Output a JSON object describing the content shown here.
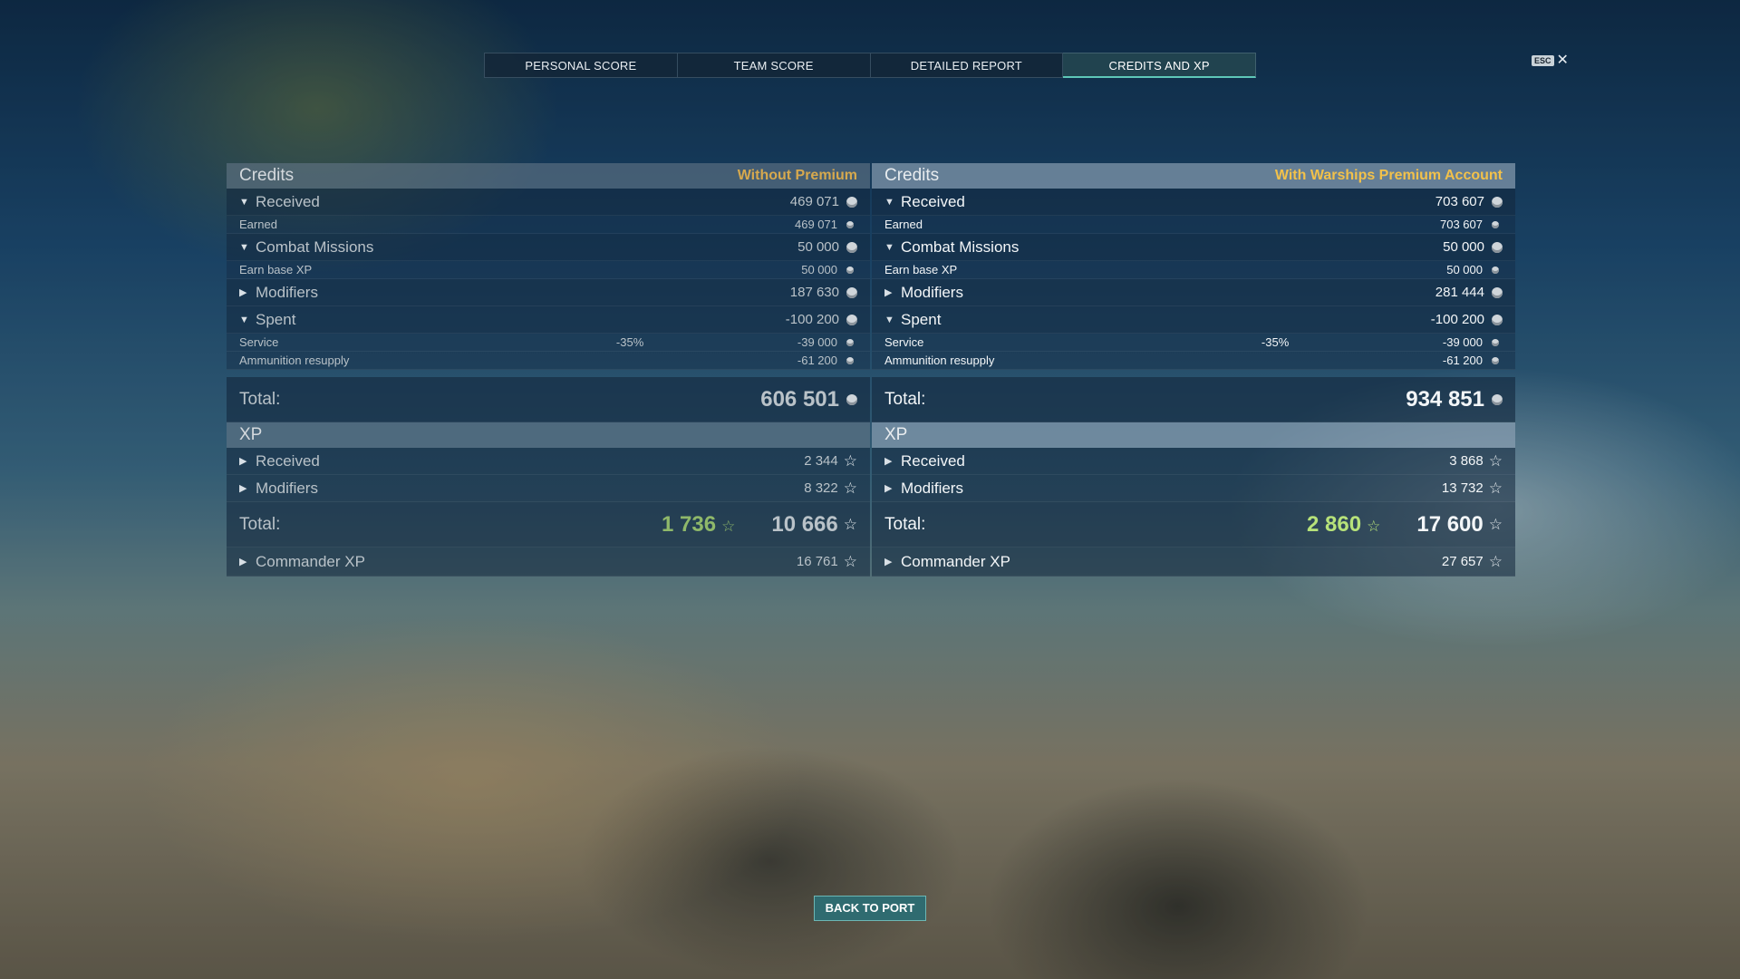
{
  "tabs": [
    "PERSONAL SCORE",
    "TEAM SCORE",
    "DETAILED REPORT",
    "CREDITS AND XP"
  ],
  "active_tab": "CREDITS AND XP",
  "esc_label": "ESC",
  "left": {
    "credits_title": "Credits",
    "note": "Without Premium",
    "received_label": "Received",
    "received_value": "469 071",
    "earned_label": "Earned",
    "earned_value": "469 071",
    "missions_label": "Combat Missions",
    "missions_value": "50 000",
    "base_xp_label": "Earn base XP",
    "base_xp_value": "50 000",
    "modifiers_label": "Modifiers",
    "modifiers_value": "187 630",
    "spent_label": "Spent",
    "spent_value": "-100 200",
    "service_label": "Service",
    "service_pct": "-35%",
    "service_value": "-39 000",
    "ammo_label": "Ammunition resupply",
    "ammo_value": "-61 200",
    "total_label": "Total:",
    "total_value": "606 501",
    "xp_title": "XP",
    "xp_received_label": "Received",
    "xp_received_value": "2 344",
    "xp_modifiers_label": "Modifiers",
    "xp_modifiers_value": "8 322",
    "xp_total_label": "Total:",
    "xp_total_green": "1 736",
    "xp_total_value": "10 666",
    "commander_label": "Commander XP",
    "commander_value": "16 761"
  },
  "right": {
    "credits_title": "Credits",
    "note": "With Warships Premium Account",
    "received_label": "Received",
    "received_value": "703 607",
    "earned_label": "Earned",
    "earned_value": "703 607",
    "missions_label": "Combat Missions",
    "missions_value": "50 000",
    "base_xp_label": "Earn base XP",
    "base_xp_value": "50 000",
    "modifiers_label": "Modifiers",
    "modifiers_value": "281 444",
    "spent_label": "Spent",
    "spent_value": "-100 200",
    "service_label": "Service",
    "service_pct": "-35%",
    "service_value": "-39 000",
    "ammo_label": "Ammunition resupply",
    "ammo_value": "-61 200",
    "total_label": "Total:",
    "total_value": "934 851",
    "xp_title": "XP",
    "xp_received_label": "Received",
    "xp_received_value": "3 868",
    "xp_modifiers_label": "Modifiers",
    "xp_modifiers_value": "13 732",
    "xp_total_label": "Total:",
    "xp_total_green": "2 860",
    "xp_total_value": "17 600",
    "commander_label": "Commander XP",
    "commander_value": "27 657"
  },
  "back_button": "BACK TO PORT",
  "colors": {
    "accent_teal": "#5ec8b8",
    "premium_gold": "#f2c14a",
    "xp_green": "#b7e27a"
  }
}
